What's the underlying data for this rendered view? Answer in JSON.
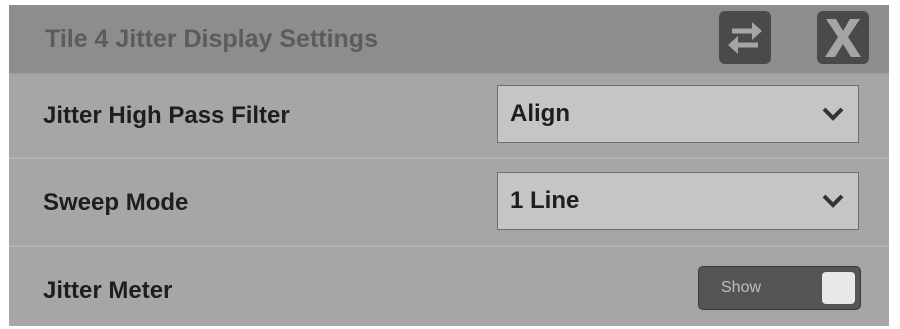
{
  "header": {
    "title": "Tile 4 Jitter Display Settings",
    "swap_icon": "swap-arrows-icon",
    "close_icon": "close-x-icon"
  },
  "settings": [
    {
      "label": "Jitter High Pass Filter",
      "value": "Align",
      "control": "dropdown"
    },
    {
      "label": "Sweep Mode",
      "value": "1 Line",
      "control": "dropdown"
    },
    {
      "label": "Jitter Meter",
      "value": "Show",
      "control": "toggle"
    }
  ],
  "colors": {
    "panel_bg": "#a6a6a6",
    "header_bg": "#8d8d8d",
    "title_text": "#5c5c5c",
    "button_bg": "#4a4a4a",
    "select_bg": "#c5c5c5",
    "toggle_bg": "#555555"
  }
}
